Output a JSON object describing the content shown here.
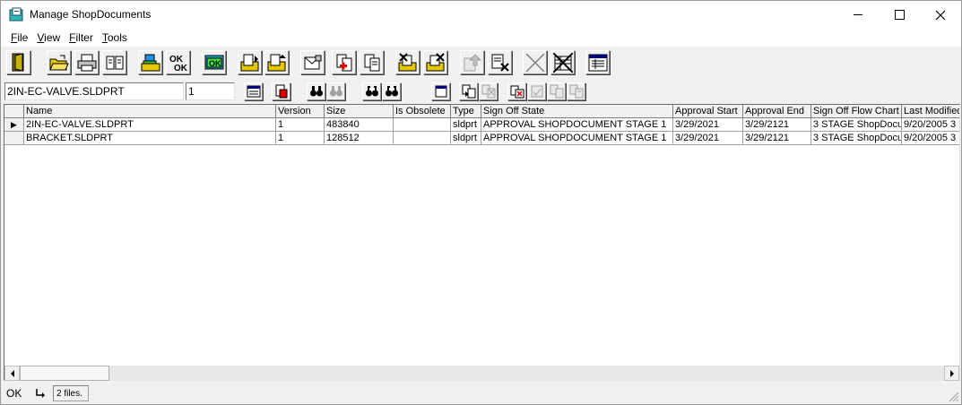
{
  "window": {
    "title": "Manage ShopDocuments"
  },
  "menu": [
    {
      "label": "File",
      "mnemonic": "F",
      "rest": "ile"
    },
    {
      "label": "View",
      "mnemonic": "V",
      "rest": "iew"
    },
    {
      "label": "Filter",
      "mnemonic": "F",
      "rest": "ilter"
    },
    {
      "label": "Tools",
      "mnemonic": "T",
      "rest": "ools"
    }
  ],
  "filter_bar": {
    "name_value": "2IN-EC-VALVE.SLDPRT",
    "version_value": "1"
  },
  "grid": {
    "columns": [
      "",
      "Name",
      "Version",
      "Size",
      "Is Obsolete",
      "Type",
      "Sign Off State",
      "Approval Start",
      "Approval End",
      "Sign Off Flow Chart",
      "Last Modified"
    ],
    "rows": [
      {
        "marker": "▶",
        "name": "2IN-EC-VALVE.SLDPRT",
        "version": "1",
        "size": "483840",
        "obsolete": "",
        "type": "sldprt",
        "state": "APPROVAL SHOPDOCUMENT STAGE 1",
        "start": "3/29/2021",
        "end": "3/29/2121",
        "flow": "3 STAGE ShopDocu",
        "modified": "9/20/2005 3"
      },
      {
        "marker": "",
        "name": "BRACKET.SLDPRT",
        "version": "1",
        "size": "128512",
        "obsolete": "",
        "type": "sldprt",
        "state": "APPROVAL SHOPDOCUMENT STAGE 1",
        "start": "3/29/2021",
        "end": "3/29/2121",
        "flow": "3 STAGE ShopDocu",
        "modified": "9/20/2005 3"
      }
    ]
  },
  "status": {
    "ok": "OK",
    "count": "2 files."
  },
  "icons": {
    "toolbar1": [
      "exit-icon",
      "open-folder-icon",
      "print-icon",
      "copy-docs-icon",
      "stamp-icon",
      "ok-ok-icon",
      "ok-icon",
      "check-in-icon",
      "check-out-icon",
      "mail-icon",
      "delete-doc-icon",
      "duplicate-doc-icon",
      "import-icon",
      "export-icon",
      "upload-disabled-icon",
      "remove-icon",
      "cancel-icon",
      "void-icon",
      "report-icon"
    ],
    "toolbar2": [
      "browse-icon",
      "find-icon",
      "binoculars-icon",
      "binoculars-disabled-icon",
      "binoculars-prev-icon",
      "binoculars-next-icon",
      "window-icon",
      "link-icon",
      "unlink-disabled-icon",
      "checkbox-doc-icon",
      "doc-disabled-icon",
      "copy-disabled-icon",
      "compare-disabled-icon"
    ]
  }
}
